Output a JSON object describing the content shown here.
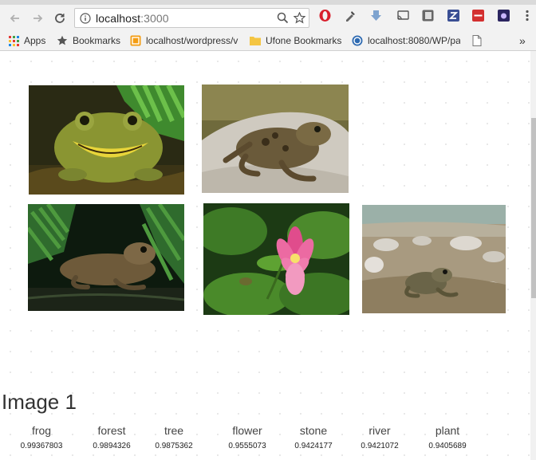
{
  "browser": {
    "address": "localhost",
    "address_port": ":3000",
    "icons": {
      "back": "arrow-left-icon",
      "forward": "arrow-right-icon",
      "reload": "reload-icon",
      "info": "info-icon",
      "zoom": "zoom-icon",
      "star": "star-icon"
    }
  },
  "bookmarks": [
    {
      "label": "Apps",
      "icon": "apps-grid-icon"
    },
    {
      "label": "Bookmarks",
      "icon": "star-icon"
    },
    {
      "label": "localhost/wordpress/v",
      "icon": "site-icon"
    },
    {
      "label": "Ufone Bookmarks",
      "icon": "folder-icon"
    },
    {
      "label": "localhost:8080/WP/pa",
      "icon": "wordpress-icon"
    },
    {
      "label": "",
      "icon": "page-icon"
    }
  ],
  "bookmarks_overflow": "»",
  "gallery": [
    {
      "name": "frog-photo-1",
      "subject": "frog with open mouth"
    },
    {
      "name": "frog-photo-2",
      "subject": "frog on stone"
    },
    {
      "name": "frog-photo-3",
      "subject": "frog among ferns"
    },
    {
      "name": "lotus-photo",
      "subject": "pink water lily"
    },
    {
      "name": "frog-photo-5",
      "subject": "frog on river stones"
    }
  ],
  "result": {
    "heading": "Image 1",
    "predictions": [
      {
        "label": "frog",
        "score": "0.99367803"
      },
      {
        "label": "forest",
        "score": "0.9894326"
      },
      {
        "label": "tree",
        "score": "0.9875362"
      },
      {
        "label": "flower",
        "score": "0.9555073"
      },
      {
        "label": "stone",
        "score": "0.9424177"
      },
      {
        "label": "river",
        "score": "0.9421072"
      },
      {
        "label": "plant",
        "score": "0.9405689"
      }
    ]
  },
  "colors": {
    "chrome_bg": "#f2f2f2",
    "page_bg": "#ffffff",
    "text": "#333333"
  }
}
